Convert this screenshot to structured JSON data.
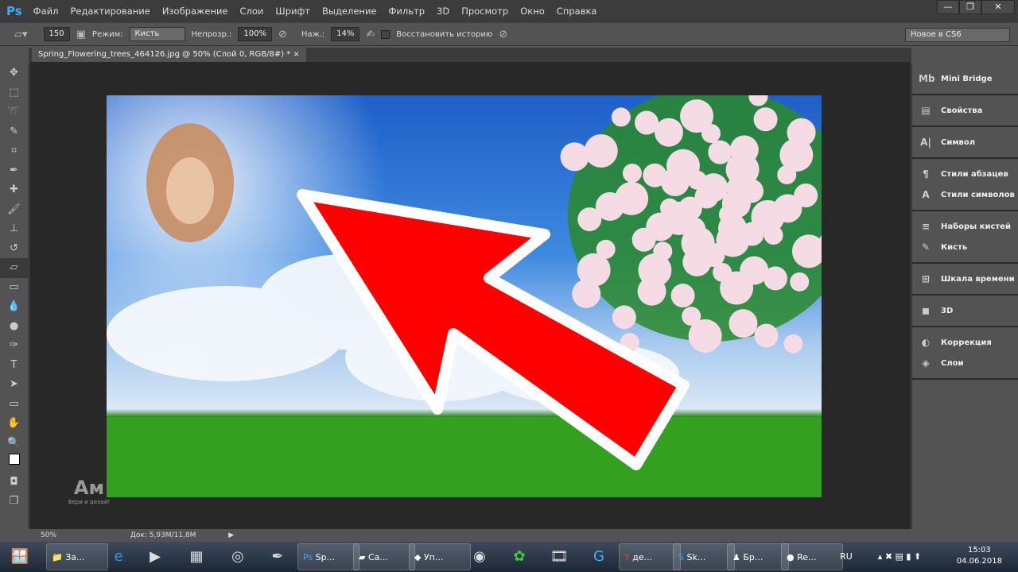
{
  "app": {
    "logo": "Ps"
  },
  "menu": [
    "Файл",
    "Редактирование",
    "Изображение",
    "Слои",
    "Шрифт",
    "Выделение",
    "Фильтр",
    "3D",
    "Просмотр",
    "Окно",
    "Справка"
  ],
  "window_controls": {
    "minimize": "—",
    "restore": "❐",
    "close": "✕"
  },
  "options": {
    "brush_size": "150",
    "mode_label": "Режим:",
    "mode_value": "Кисть",
    "opacity_label": "Непрозр.:",
    "opacity_value": "100%",
    "flow_label": "Наж.:",
    "flow_value": "14%",
    "restore_history_label": "Восстановить историю",
    "workspace_preset": "Новое в CS6"
  },
  "document": {
    "tab_title": "Spring_Flowering_trees_464126.jpg @ 50% (Слой 0, RGB/8#) *",
    "close": "×"
  },
  "status": {
    "zoom": "50%",
    "doc_size": "Док: 5,93M/11,8M"
  },
  "panels": [
    [
      "Mini Bridge"
    ],
    [
      "Свойства"
    ],
    [
      "Символ"
    ],
    [
      "Стили абзацев",
      "Стили символов"
    ],
    [
      "Наборы кистей",
      "Кисть"
    ],
    [
      "Шкала времени"
    ],
    [
      "3D"
    ],
    [
      "Коррекция",
      "Слои"
    ]
  ],
  "panel_icons": [
    [
      "Mb"
    ],
    [
      "▤"
    ],
    [
      "A|"
    ],
    [
      "¶",
      "A"
    ],
    [
      "≡",
      "✎"
    ],
    [
      "⊞"
    ],
    [
      "◼"
    ],
    [
      "◐",
      "◈"
    ]
  ],
  "watermark": {
    "text": "Ам",
    "subtitle": "Бери и делай!"
  },
  "taskbar": {
    "items": [
      "За...",
      "Sp...",
      "Са...",
      "Уп...",
      "де...",
      "Sk...",
      "Бр...",
      "Re..."
    ],
    "lang": "RU",
    "time": "15:03",
    "date": "04.06.2018"
  },
  "colors": {
    "arrow": "#ff0000",
    "accent": "#3fa9f5"
  }
}
